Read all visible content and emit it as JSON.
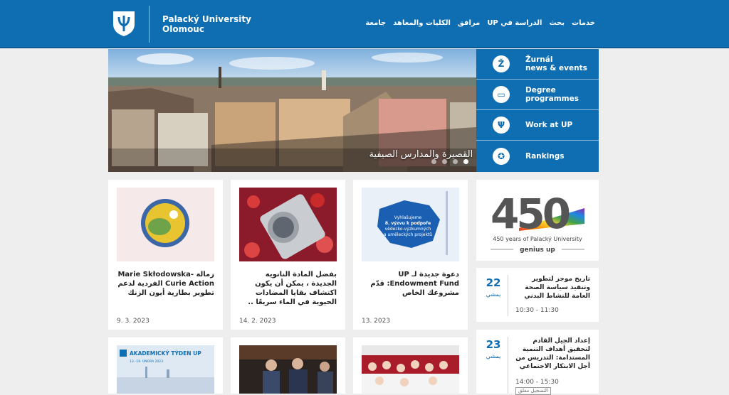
{
  "header": {
    "university_line1": "Palacký University",
    "university_line2": "Olomouc",
    "nav": [
      "خدمات",
      "بحث",
      "UP الدراسة في",
      "مرافق",
      "الكليات والمعاهد",
      "جامعة"
    ]
  },
  "hero": {
    "caption": "البرامج القصيرة والمدارس الصيفية",
    "slides": 4,
    "active_slide": 4
  },
  "quick_links": [
    {
      "icon": "zurnal-icon",
      "glyph": "Ž",
      "label1": "Žurnál",
      "label2": "news & events"
    },
    {
      "icon": "folder-icon",
      "glyph": "▭",
      "label1": "Degree",
      "label2": "programmes"
    },
    {
      "icon": "up-logo-icon",
      "glyph": "Ψ",
      "label1": "Work at UP",
      "label2": ""
    },
    {
      "icon": "award-icon",
      "glyph": "✪",
      "label1": "Rankings",
      "label2": ""
    }
  ],
  "news": [
    {
      "title": "زمالة Marie Skłodowska-Curie Action الفردية لدعم تطوير بطارية أيون الزنك",
      "date": "9. 3. 2023"
    },
    {
      "title": "بفضل المادة النانوية الجديدة ، يمكن أن يكون اكتشاف بقايا المضادات الحيوية في الماء سريعًا ..",
      "date": "14. 2. 2023"
    },
    {
      "title": "دعوة جديدة لـ UP Endowment Fund: قدّم مشروعك الخاص",
      "date": "13. 2023"
    }
  ],
  "thumb3_text": {
    "l1": "Vyhlašujeme",
    "l2": "8. výzvu k podpoře",
    "l3": "vědecko-výzkumných",
    "l4": "a uměleckých projektů"
  },
  "bottom_cards": {
    "akademicky_title": "AKADEMICKÝ TÝDEN UP",
    "akademicky_dates": "13.–19. ÚNORA 2023"
  },
  "anniversary": {
    "number": "450",
    "caption": "450 years of Palacký University",
    "slogan": "genius up"
  },
  "events": [
    {
      "day": "22",
      "month": "يمشي",
      "title": "تاريخ موجز لتطوير وتنفيذ سياسة الصحة العامة للنشاط البدني",
      "time": "10:30 - 11:30"
    },
    {
      "day": "23",
      "month": "يمشي",
      "title": "إعداد الجيل القادم لتحقيق أهداف التنمية المستدامة: التدريس من أجل الابتكار الاجتماعي",
      "time": "14:00 - 15:30",
      "tag": "التسجيل مغلق"
    }
  ],
  "colors": {
    "brand_blue": "#0f6db2",
    "page_bg": "#eeeeee"
  }
}
